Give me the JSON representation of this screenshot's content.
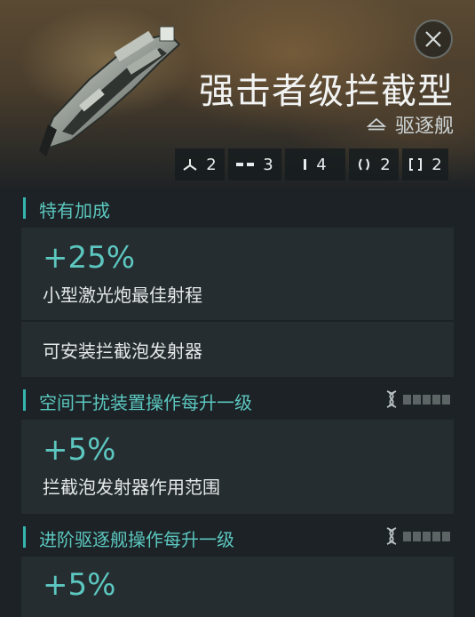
{
  "ship": {
    "name": "强击者级拦截型",
    "class_label": "驱逐舰",
    "class_icon": "destroyer-hull-icon"
  },
  "close_icon": "close-icon",
  "slots": [
    {
      "icon": "high-slot-icon",
      "count": "2"
    },
    {
      "icon": "mid-slot-icon",
      "count": "3"
    },
    {
      "icon": "low-slot-icon",
      "count": "4"
    },
    {
      "icon": "rig-slot-icon",
      "count": "2"
    },
    {
      "icon": "subsystem-slot-icon",
      "count": "2"
    }
  ],
  "sections": {
    "role": {
      "title": "特有加成",
      "bonus_value": "+25%",
      "bonus_desc": "小型激光炮最佳射程",
      "note": "可安装拦截泡发射器"
    },
    "skill1": {
      "title": "空间干扰装置操作每升一级",
      "skill_icon": "skill-dna-icon",
      "trained_levels": 0,
      "max_levels": 5,
      "bonus_value": "+5%",
      "bonus_desc": "拦截泡发射器作用范围"
    },
    "skill2": {
      "title": "进阶驱逐舰操作每升一级",
      "skill_icon": "skill-dna-icon",
      "trained_levels": 0,
      "max_levels": 5,
      "bonus_value": "+5%"
    }
  },
  "colors": {
    "accent": "#5cc7c0",
    "card_bg": "#262d30",
    "panel_bg": "#1c2225",
    "pip_empty": "#5d6466"
  }
}
